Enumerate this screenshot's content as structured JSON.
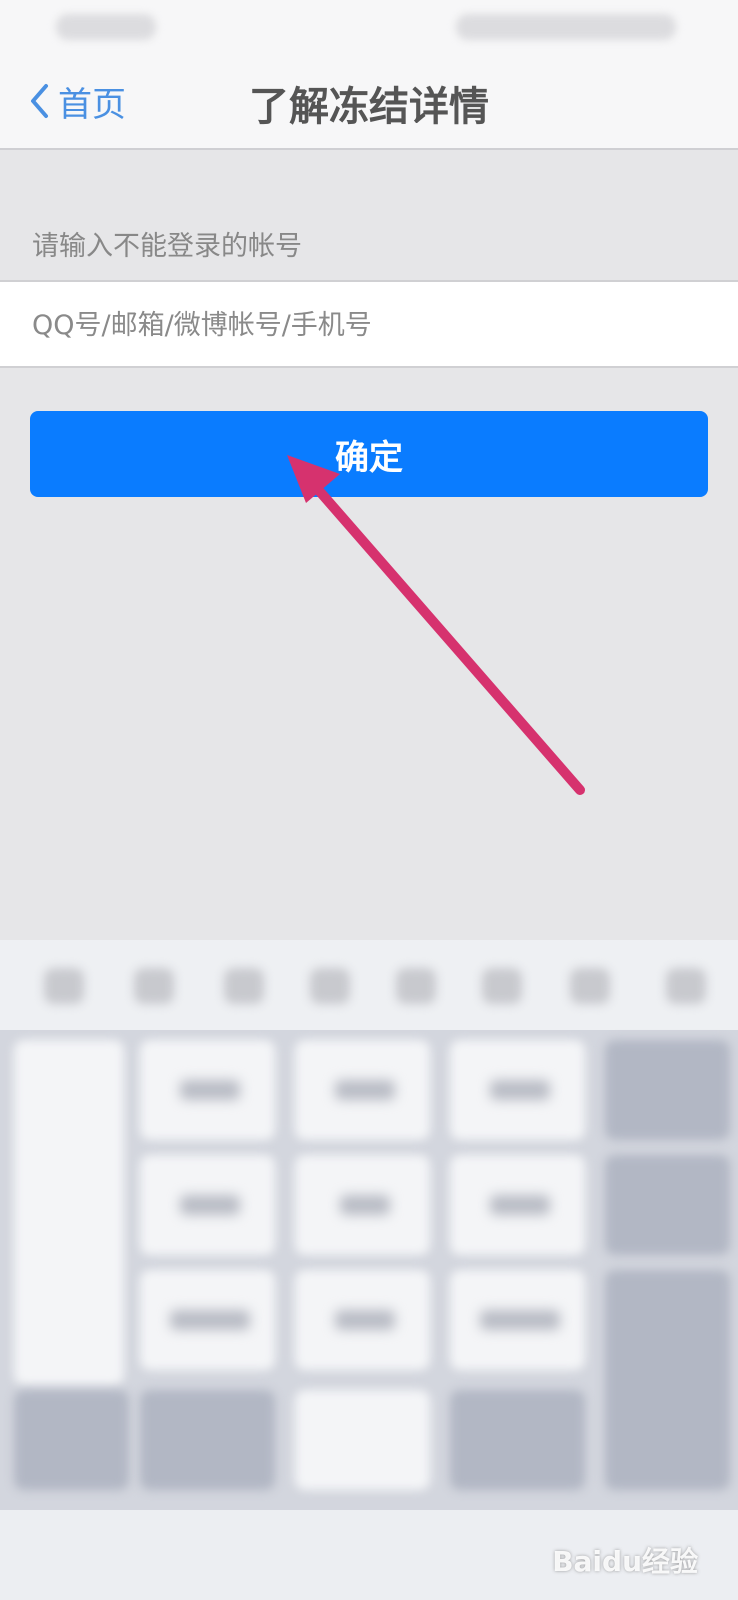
{
  "nav": {
    "back_label": "首页",
    "title": "了解冻结详情"
  },
  "form": {
    "hint": "请输入不能登录的帐号",
    "account_placeholder": "QQ号/邮箱/微博帐号/手机号",
    "account_value": "",
    "confirm_label": "确定"
  },
  "colors": {
    "accent": "#0a7cff",
    "back_link": "#4a90e2",
    "annotation_arrow": "#d6326e"
  },
  "icons": {
    "back": "chevron-left-icon",
    "annotation": "arrow-annotation-icon"
  },
  "watermark": "Baidu经验"
}
